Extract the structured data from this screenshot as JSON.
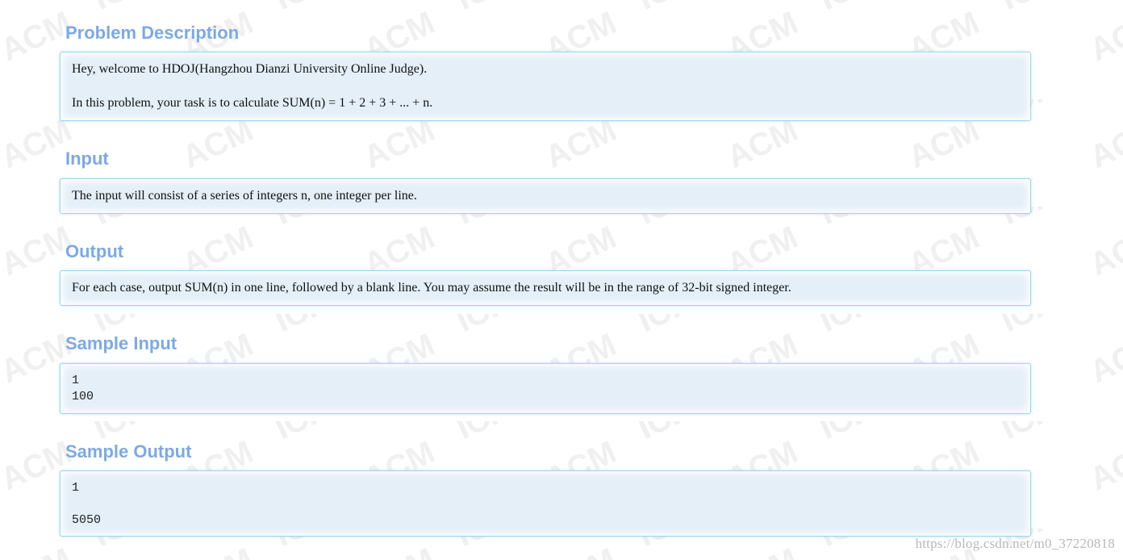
{
  "background_watermark": {
    "tiles": [
      "ACM",
      "ICPC"
    ],
    "color": "#d6d6d6"
  },
  "sections": {
    "description": {
      "title": "Problem Description",
      "lines": [
        "Hey, welcome to HDOJ(Hangzhou Dianzi University Online Judge).",
        "In this problem, your task is to calculate SUM(n) = 1 + 2 + 3 + ... + n."
      ]
    },
    "input": {
      "title": "Input",
      "lines": [
        "The input will consist of a series of integers n, one integer per line."
      ]
    },
    "output": {
      "title": "Output",
      "lines": [
        "For each case, output SUM(n) in one line, followed by a blank line. You may assume the result will be in the range of 32-bit signed integer."
      ]
    },
    "sample_input": {
      "title": "Sample Input",
      "lines": [
        "1",
        "100"
      ]
    },
    "sample_output": {
      "title": "Sample Output",
      "lines": [
        "1",
        "",
        "5050"
      ]
    }
  },
  "footer_watermark": "https://blog.csdn.net/m0_37220818",
  "colors": {
    "title": "#7ca9e6",
    "panel_bg": "#e4eff8",
    "panel_border": "#9fd7f2",
    "text": "#111111"
  }
}
